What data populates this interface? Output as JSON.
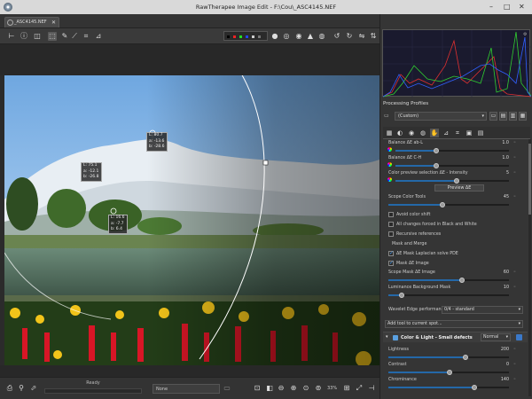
{
  "window": {
    "title": "RawTherapee Image Edit - F:\\Cou\\_ASC4145.NEF",
    "min": "–",
    "max": "□",
    "close": "✕"
  },
  "tab": {
    "label": "_ASC4145.NEF",
    "close": "✕"
  },
  "toolbar_icons": [
    "hand-icon",
    "info-icon",
    "before-after-icon",
    "crop-select-icon",
    "color-picker-icon",
    "straighten-icon",
    "crop-icon",
    "transform-icon"
  ],
  "status": {
    "ready": "Ready",
    "profile": "None",
    "zoom": "33%"
  },
  "overlay_readouts": [
    {
      "l": "L: 80.7",
      "a": "a: -13.6",
      "b": "b: -28.6"
    },
    {
      "l": "L: 75.1",
      "a": "a: -12.1",
      "b": "b: -26.8"
    },
    {
      "l": "L: 16.6",
      "a": "a: -7.7",
      "b": "b: 6.4"
    }
  ],
  "histogram": {
    "colors": {
      "red": "#e03030",
      "green": "#30d030",
      "blue": "#3060ff",
      "bg": "#1a1a2e"
    }
  },
  "profiles": {
    "header": "Processing Profiles",
    "selected": "(Custom)"
  },
  "tools": {
    "balance_ab": {
      "label": "Balance ΔE ab-L",
      "value": "1.0"
    },
    "balance_ch": {
      "label": "Balance ΔE C-H",
      "value": "1.0"
    },
    "preview_intensity": {
      "label": "Color preview selection ΔE - Intensity",
      "value": "5"
    },
    "preview_button": "Preview ΔE",
    "scope_tools": {
      "label": "Scope Color Tools",
      "value": "45"
    },
    "avoid_shift": "Avoid color shift",
    "bw_changes": "All changes forced in Black and White",
    "recursive": "Recursive references",
    "mask_merge": "Mask and Merge",
    "laplacian": "ΔE Mask Laplacian solve PDE",
    "mask_image": "Mask ΔE Image",
    "scope_mask": {
      "label": "Scope Mask ΔE Image",
      "value": "60"
    },
    "lum_bg_mask": {
      "label": "Luminance Background Mask",
      "value": "10"
    },
    "wavelet_edge": {
      "label": "Wavelet Edge performance",
      "value": "0/4 - standard"
    },
    "add_tool": "Add tool to current spot...",
    "section": {
      "title": "Color & Light - Small defects",
      "mode": "Normal"
    },
    "lightness": {
      "label": "Lightness",
      "value": "200"
    },
    "contrast": {
      "label": "Contrast",
      "value": "0"
    },
    "chrominance": {
      "label": "Chrominance",
      "value": "140"
    }
  }
}
